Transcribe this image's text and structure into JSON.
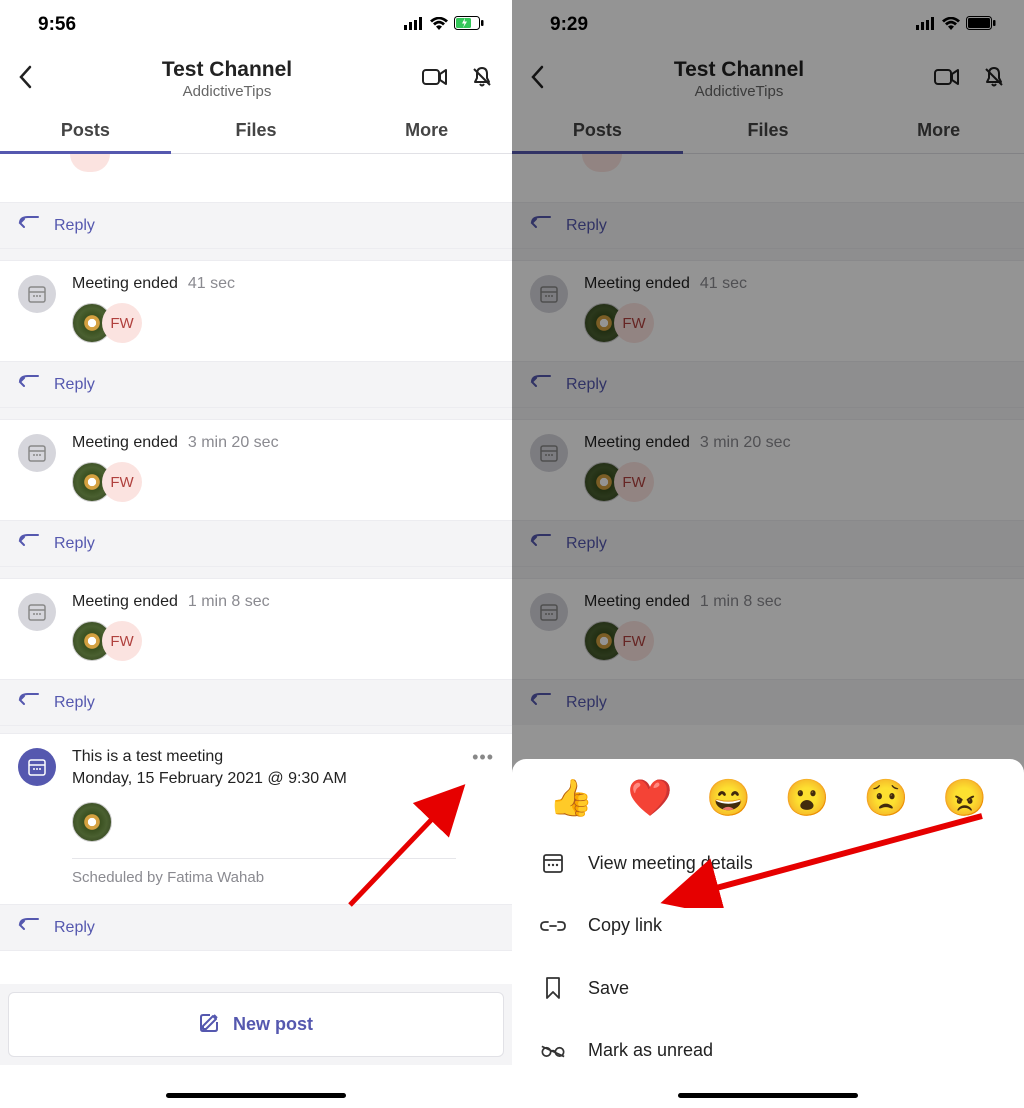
{
  "left": {
    "statusTime": "9:56",
    "header": {
      "title": "Test Channel",
      "subtitle": "AddictiveTips"
    },
    "tabs": {
      "posts": "Posts",
      "files": "Files",
      "more": "More"
    },
    "replyLabel": "Reply",
    "meetingEnded": "Meeting ended",
    "durations": [
      "41 sec",
      "3 min 20 sec",
      "1 min 8 sec"
    ],
    "fwInitials": "FW",
    "meeting": {
      "title": "This is a test meeting",
      "when": "Monday, 15 February 2021 @ 9:30 AM",
      "scheduledBy": "Scheduled by Fatima Wahab"
    },
    "newPost": "New post"
  },
  "right": {
    "statusTime": "9:29",
    "header": {
      "title": "Test Channel",
      "subtitle": "AddictiveTips"
    },
    "tabs": {
      "posts": "Posts",
      "files": "Files",
      "more": "More"
    },
    "replyLabel": "Reply",
    "meetingEnded": "Meeting ended",
    "durations": [
      "41 sec",
      "3 min 20 sec",
      "1 min 8 sec"
    ],
    "fwInitials": "FW",
    "reactions": [
      "👍",
      "❤️",
      "😄",
      "😮",
      "😟",
      "😠"
    ],
    "menu": {
      "viewDetails": "View meeting details",
      "copyLink": "Copy link",
      "save": "Save",
      "markUnread": "Mark as unread"
    }
  }
}
